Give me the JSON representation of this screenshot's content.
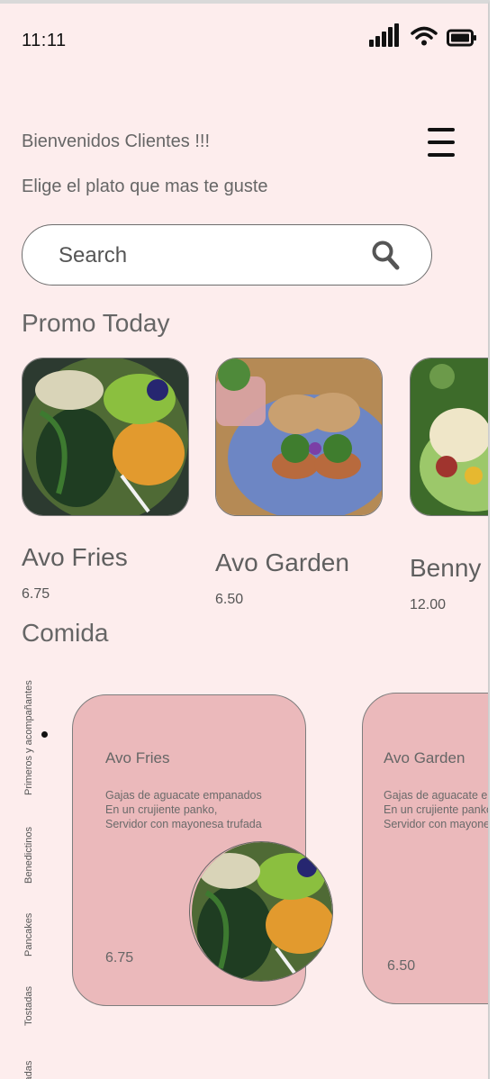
{
  "status_bar": {
    "time": "11:11",
    "icons": [
      "cellular-signal-icon",
      "wifi-icon",
      "battery-icon"
    ]
  },
  "header": {
    "greeting": "Bienvenidos Clientes !!!",
    "subtitle": "Elige el plato que mas te guste",
    "menu_icon": "hamburger-menu-icon"
  },
  "search": {
    "placeholder": "Search",
    "icon": "search-icon"
  },
  "promo": {
    "title": "Promo Today",
    "items": [
      {
        "name": "Avo Fries",
        "price": "6.75",
        "image": "avocado-bowl-photo"
      },
      {
        "name": "Avo Garden",
        "price": "6.50",
        "image": "bagel-plate-photo"
      },
      {
        "name": "Benny",
        "price": "12.00",
        "image": "benedict-photo"
      }
    ]
  },
  "comida": {
    "title": "Comida",
    "categories": [
      {
        "label": "Primeros y acompañantes",
        "active": true
      },
      {
        "label": "Benedictinos",
        "active": false
      },
      {
        "label": "Pancakes",
        "active": false
      },
      {
        "label": "Tostadas",
        "active": false
      },
      {
        "label": "Ensaladas",
        "active": false
      }
    ],
    "dishes": [
      {
        "name": "Avo Fries",
        "description": [
          "Gajas de aguacate empanados",
          "En un crujiente panko,",
          "Servidor con mayonesa trufada"
        ],
        "price": "6.75",
        "image": "avocado-bowl-photo"
      },
      {
        "name": "Avo Garden",
        "description": [
          "Gajas de aguacate empanados",
          "En un crujiente panko,",
          "Servidor con mayonesa trufada"
        ],
        "price": "6.50"
      }
    ]
  },
  "colors": {
    "background": "#fdeded",
    "card": "#ebb9bb",
    "text": "#666666",
    "icon": "#111111"
  }
}
